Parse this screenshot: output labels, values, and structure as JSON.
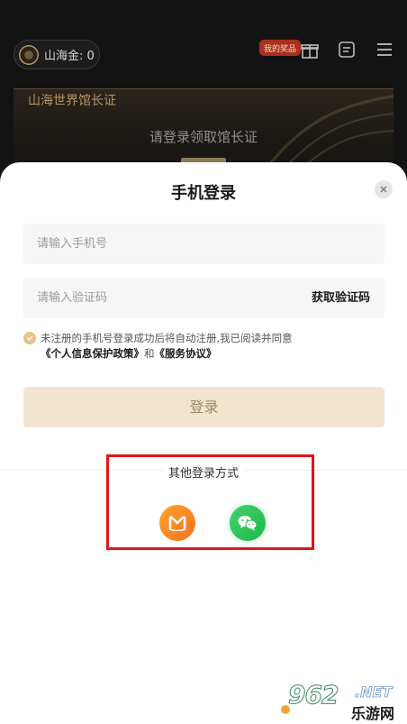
{
  "background": {
    "coin_label": "山海金: 0",
    "reward_badge": "我的奖品",
    "certificate_title": "山海世界馆长证",
    "certificate_subtitle": "请登录领取馆长证"
  },
  "login_sheet": {
    "title": "手机登录",
    "phone_placeholder": "请输入手机号",
    "code_placeholder": "请输入验证码",
    "get_code_label": "获取验证码",
    "agreement_prefix": "未注册的手机号登录成功后将自动注册,我已阅读并同意",
    "privacy_link": "《个人信息保护政策》",
    "and_text": "和",
    "service_link": "《服务协议》",
    "login_button": "登录",
    "other_methods_title": "其他登录方式"
  },
  "watermark": {
    "number": "962",
    "domain": ".NET",
    "site_name": "乐游网"
  },
  "colors": {
    "accent_gold": "#e7c485",
    "login_button_bg": "#f2e5cf",
    "highlight_red": "#e0141c",
    "wechat_green": "#2cc75a",
    "migu_orange": "#f7891f"
  },
  "icons": {
    "close": "close-icon",
    "gift": "gift-icon",
    "note": "note-icon",
    "menu": "menu-icon",
    "check": "check-icon",
    "migu": "migu-logo-icon",
    "wechat": "wechat-icon"
  }
}
